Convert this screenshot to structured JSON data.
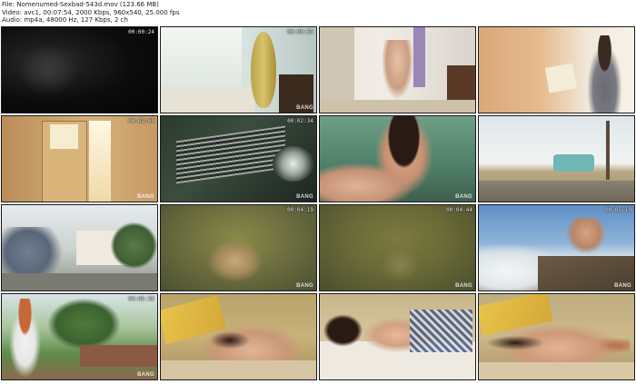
{
  "info": {
    "file_line": "File: Nomenumed-Sexbad-543d.mov (123.66 MB)",
    "video_line": "Video: avc1, 00:07:54, 2000 Kbps, 960x540, 25.000 fps",
    "audio_line": "Audio: mp4a, 48000 Hz, 127 Kbps, 2 ch"
  },
  "watermark": "BANG",
  "thumbnails": [
    {
      "time": "00:00:24"
    },
    {
      "time": "00:00:59"
    },
    {
      "time": ""
    },
    {
      "time": ""
    },
    {
      "time": "00:02:00"
    },
    {
      "time": "00:02:34"
    },
    {
      "time": ""
    },
    {
      "time": ""
    },
    {
      "time": ""
    },
    {
      "time": "00:04:19"
    },
    {
      "time": "00:04:44"
    },
    {
      "time": "00:05:10"
    },
    {
      "time": "00:05:36"
    },
    {
      "time": ""
    },
    {
      "time": ""
    },
    {
      "time": ""
    }
  ]
}
